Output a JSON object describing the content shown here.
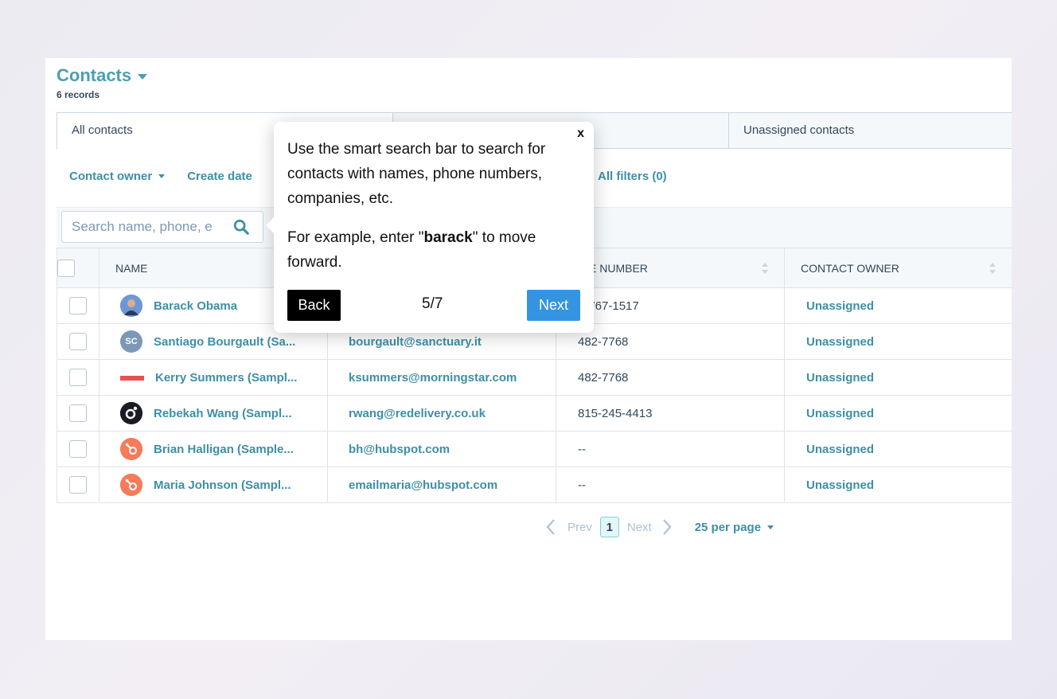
{
  "header": {
    "title": "Contacts",
    "records": "6 records"
  },
  "tabs": [
    {
      "label": "All contacts"
    },
    {
      "label": ""
    },
    {
      "label": "Unassigned contacts"
    }
  ],
  "filters": {
    "contact_owner": "Contact owner",
    "create_date": "Create date",
    "all_filters": "All filters (0)"
  },
  "search": {
    "value": "Search name, phone, e"
  },
  "table": {
    "columns": [
      "NAME",
      "",
      "ONE NUMBER",
      "CONTACT OWNER"
    ],
    "rows": [
      {
        "name": "Barack Obama",
        "avatar": "photo",
        "email": "",
        "phone": "4-767-1517",
        "owner": "Unassigned"
      },
      {
        "name": "Santiago Bourgault (Sa...",
        "avatar": "SC",
        "email": "bourgault@sanctuary.it",
        "phone": "482-7768",
        "owner": "Unassigned"
      },
      {
        "name": "Kerry Summers (Sampl...",
        "avatar": "logo",
        "email": "ksummers@morningstar.com",
        "phone": "482-7768",
        "owner": "Unassigned"
      },
      {
        "name": "Rebekah Wang (Sampl...",
        "avatar": "logo",
        "email": "rwang@redelivery.co.uk",
        "phone": "815-245-4413",
        "owner": "Unassigned"
      },
      {
        "name": "Brian Halligan (Sample...",
        "avatar": "hubspot",
        "email": "bh@hubspot.com",
        "phone": "--",
        "owner": "Unassigned"
      },
      {
        "name": "Maria Johnson (Sampl...",
        "avatar": "hubspot",
        "email": "emailmaria@hubspot.com",
        "phone": "--",
        "owner": "Unassigned"
      }
    ]
  },
  "pagination": {
    "prev": "Prev",
    "page": "1",
    "next": "Next",
    "per_page": "25 per page"
  },
  "tooltip": {
    "close": "x",
    "text1": "Use the smart search bar to search for contacts with names, phone numbers, companies, etc.",
    "text2_before": "For example, enter \"",
    "text2_bold": "barack",
    "text2_after": "\" to move forward.",
    "back": "Back",
    "counter": "5/7",
    "next": "Next"
  },
  "colors": {
    "accent": "#3d8fa7",
    "next_button": "#3594e2"
  }
}
